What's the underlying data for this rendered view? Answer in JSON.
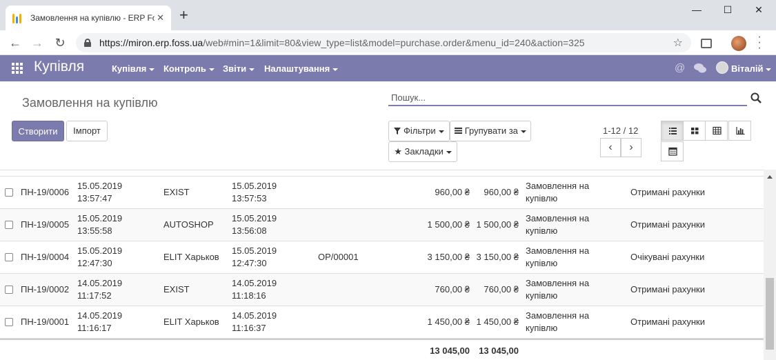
{
  "browser": {
    "tab_title": "Замовлення на купівлю - ERP Fo",
    "new_tab": "+",
    "close_tab": "✕",
    "minimize": "—",
    "maximize": "☐",
    "close_window": "✕",
    "url_domain": "https://miron.erp.foss.ua",
    "url_path": "/web#min=1&limit=80&view_type=list&model=purchase.order&menu_id=240&action=325"
  },
  "nav": {
    "brand": "Купівля",
    "menu": [
      "Купівля",
      "Контроль",
      "Звіти",
      "Налаштування"
    ],
    "user": "Віталій",
    "accent": "#7c7bad"
  },
  "control_panel": {
    "breadcrumb": "Замовлення на купівлю",
    "search_placeholder": "Пошук...",
    "create": "Створити",
    "import": "Імпорт",
    "filters": "Фільтри",
    "group_by": "Групувати за",
    "favorites": "Закладки",
    "pager": "1-12 / 12"
  },
  "rows": [
    {
      "ref": "ПН-19/0006",
      "date1": "15.05.2019",
      "time1": "13:57:47",
      "vendor": "EXIST",
      "date2": "15.05.2019",
      "time2": "13:57:53",
      "source": "",
      "untaxed": "960,00 ₴",
      "total": "960,00 ₴",
      "status1": "Замовлення на",
      "status2": "купівлю",
      "invoice": "Отримані рахунки"
    },
    {
      "ref": "ПН-19/0005",
      "date1": "15.05.2019",
      "time1": "13:55:58",
      "vendor": "AUTOSHOP",
      "date2": "15.05.2019",
      "time2": "13:56:08",
      "source": "",
      "untaxed": "1 500,00 ₴",
      "total": "1 500,00 ₴",
      "status1": "Замовлення на",
      "status2": "купівлю",
      "invoice": "Отримані рахунки"
    },
    {
      "ref": "ПН-19/0004",
      "date1": "15.05.2019",
      "time1": "12:47:30",
      "vendor": "ELIT Харьков",
      "date2": "15.05.2019",
      "time2": "12:47:30",
      "source": "OP/00001",
      "untaxed": "3 150,00 ₴",
      "total": "3 150,00 ₴",
      "status1": "Замовлення на",
      "status2": "купівлю",
      "invoice": "Очікувані рахунки"
    },
    {
      "ref": "ПН-19/0002",
      "date1": "14.05.2019",
      "time1": "11:17:52",
      "vendor": "EXIST",
      "date2": "14.05.2019",
      "time2": "11:18:16",
      "source": "",
      "untaxed": "760,00 ₴",
      "total": "760,00 ₴",
      "status1": "Замовлення на",
      "status2": "купівлю",
      "invoice": "Отримані рахунки"
    },
    {
      "ref": "ПН-19/0001",
      "date1": "14.05.2019",
      "time1": "11:16:17",
      "vendor": "ELIT Харьков",
      "date2": "14.05.2019",
      "time2": "11:16:37",
      "source": "",
      "untaxed": "1 450,00 ₴",
      "total": "1 450,00 ₴",
      "status1": "Замовлення на",
      "status2": "купівлю",
      "invoice": "Отримані рахунки"
    }
  ],
  "totals": {
    "untaxed": "13 045,00",
    "total": "13 045,00"
  }
}
